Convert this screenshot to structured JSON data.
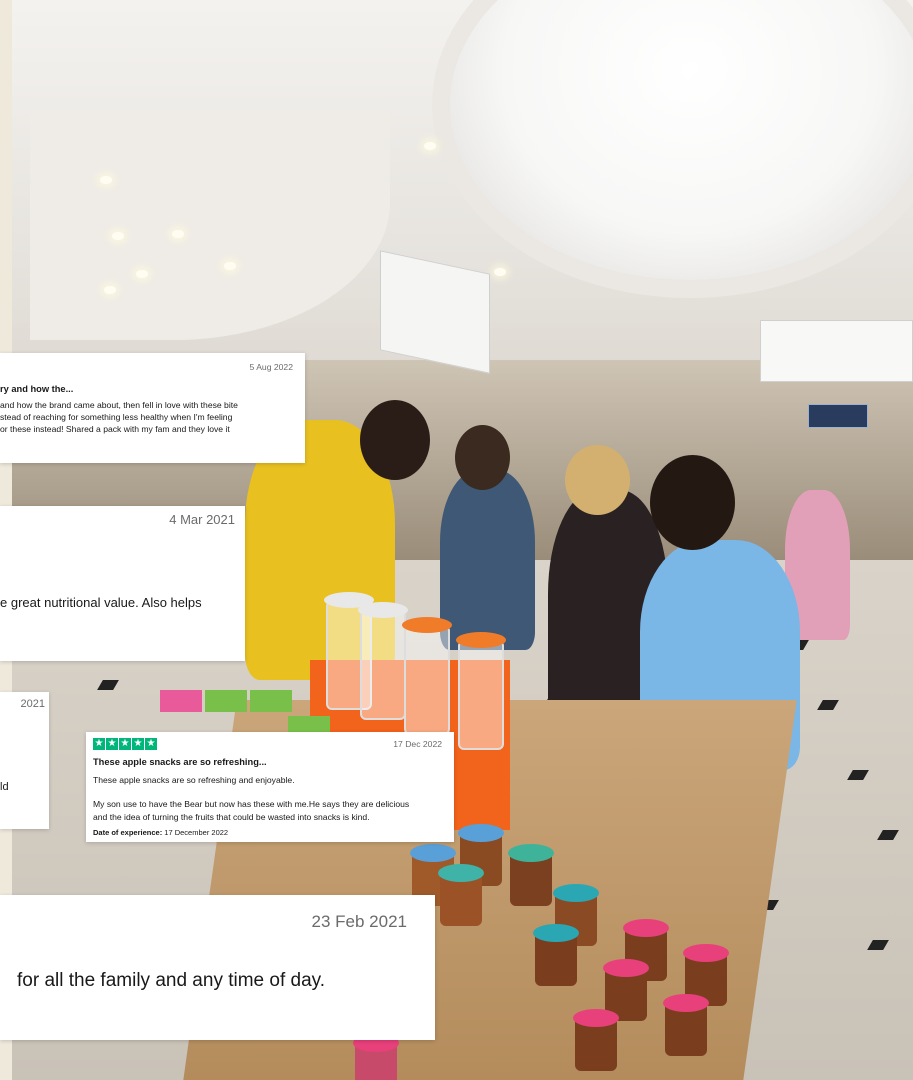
{
  "reviews": [
    {
      "date": "5 Aug 2022",
      "title": "ry and how the...",
      "lines": [
        "and how the brand came about, then fell in love with these bite",
        "stead of reaching for something less healthy when I'm feeling",
        "or these instead! Shared a pack with my fam and they love it"
      ]
    },
    {
      "date": "4 Mar 2021",
      "lines": [
        "e great nutritional value. Also helps"
      ]
    },
    {
      "date": "2021",
      "lines": [
        "ld"
      ]
    },
    {
      "stars": [
        "★",
        "★",
        "★",
        "★",
        "★"
      ],
      "date": "17 Dec 2022",
      "title": "These apple snacks are so refreshing...",
      "lines": [
        "These apple snacks are so refreshing and enjoyable.",
        "My son use to have the Bear but now has these with me.He says they are delicious",
        "and the idea of turning the fruits that could be wasted into snacks is kind."
      ],
      "experience_label": "Date of experience:",
      "experience_value": "17 December 2022"
    },
    {
      "date": "23 Feb 2021",
      "lines": [
        "for all the family and any time of day."
      ]
    }
  ],
  "colors": {
    "star_green": "#00b67a",
    "card_bg": "#ffffff",
    "date_gray": "#6b6b6b"
  }
}
